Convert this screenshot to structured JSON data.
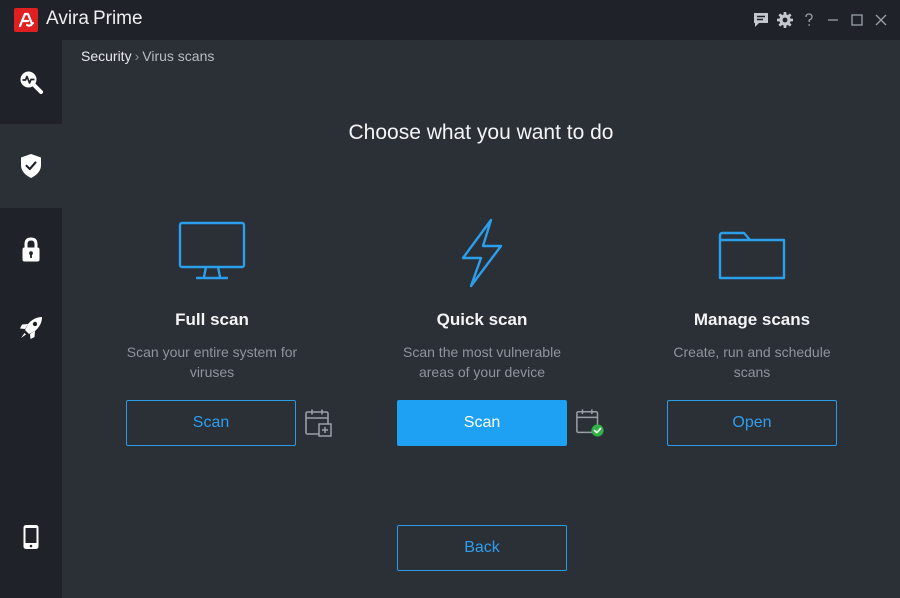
{
  "app": {
    "brand": "Avira",
    "tier": "Prime"
  },
  "breadcrumb": {
    "first": "Security",
    "separator": "›",
    "current": "Virus scans"
  },
  "page": {
    "title": "Choose what you want to do"
  },
  "options": [
    {
      "icon": "monitor-icon",
      "title": "Full scan",
      "description": "Scan your entire system for viruses",
      "button_label": "Scan",
      "schedule_icon": "calendar-add-icon"
    },
    {
      "icon": "lightning-icon",
      "title": "Quick scan",
      "description": "Scan the most vulnerable areas of your device",
      "button_label": "Scan",
      "schedule_icon": "calendar-check-icon"
    },
    {
      "icon": "folder-icon",
      "title": "Manage scans",
      "description": "Create, run and schedule scans",
      "button_label": "Open"
    }
  ],
  "back_label": "Back",
  "sidebar": {
    "items": [
      {
        "icon": "magnifier-pulse-icon",
        "active": false
      },
      {
        "icon": "shield-check-icon",
        "active": true
      },
      {
        "icon": "lock-icon",
        "active": false
      },
      {
        "icon": "rocket-icon",
        "active": false
      },
      {
        "icon": "mobile-phone-icon",
        "active": false
      }
    ]
  },
  "window_controls": [
    "feedback-icon",
    "gear-icon",
    "help-icon",
    "minimize-icon",
    "maximize-icon",
    "close-icon"
  ],
  "colors": {
    "accent": "#1ea1f2",
    "background": "#2b2f36",
    "sidebar": "#1f2329",
    "brand_red": "#e02020",
    "success": "#2fb344"
  }
}
